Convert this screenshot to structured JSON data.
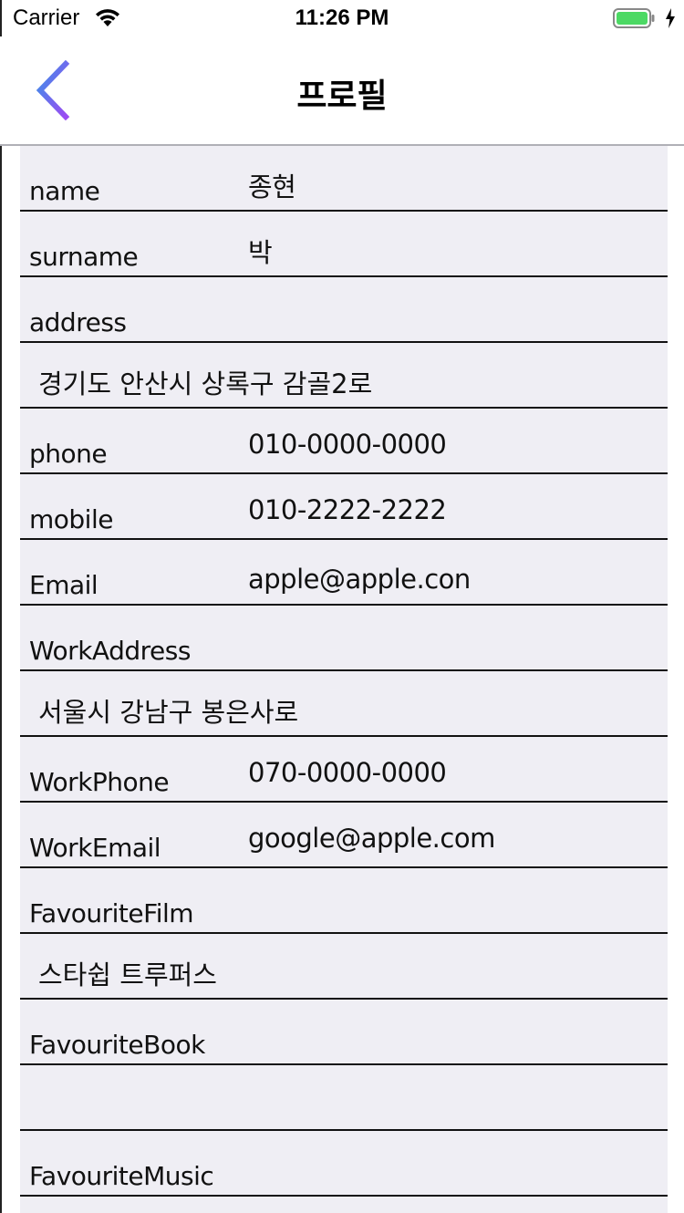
{
  "status_bar": {
    "carrier": "Carrier",
    "time": "11:26 PM",
    "battery_color": "#4cd964"
  },
  "nav": {
    "title": "프로필",
    "back_icon": "chevron-left-icon",
    "accent_gradient": [
      "#3d8fe8",
      "#9b4cf2"
    ]
  },
  "profile": {
    "name_label": "name",
    "name_value": "종현",
    "surname_label": "surname",
    "surname_value": "박",
    "address_label": "address",
    "address_value": "경기도 안산시 상록구 감골2로",
    "phone_label": "phone",
    "phone_value": "010-0000-0000",
    "mobile_label": "mobile",
    "mobile_value": "010-2222-2222",
    "email_label": "Email",
    "email_value": "apple@apple.con",
    "work_address_label": "WorkAddress",
    "work_address_value": "서울시 강남구 봉은사로",
    "work_phone_label": "WorkPhone",
    "work_phone_value": "070-0000-0000",
    "work_email_label": "WorkEmail",
    "work_email_value": "google@apple.com",
    "favourite_film_label": "FavouriteFilm",
    "favourite_film_value": "스타쉽 트루퍼스",
    "favourite_book_label": "FavouriteBook",
    "favourite_book_value": "",
    "favourite_music_label": "FavouriteMusic"
  }
}
